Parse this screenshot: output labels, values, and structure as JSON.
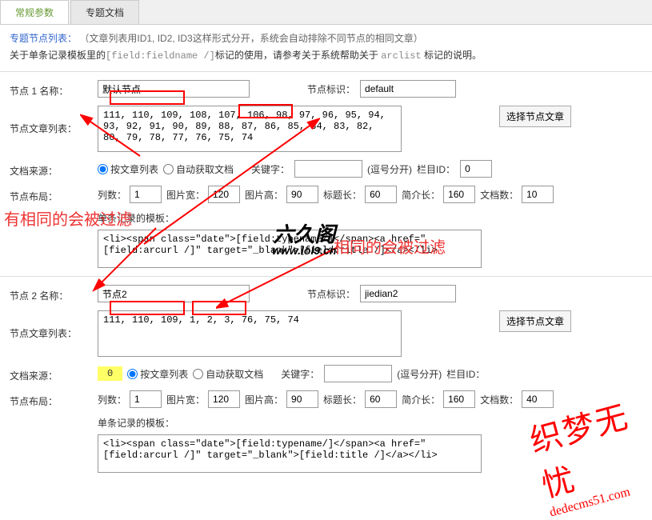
{
  "tabs": {
    "regular": "常规参数",
    "special": "专题文档"
  },
  "info": {
    "title": "专题节点列表：",
    "paren": "（文章列表用ID1, ID2, ID3这样形式分开，系统会自动排除不同节点的相同文章）",
    "line2a": "关于单条记录模板里的",
    "line2_mono1": "[field:fieldname /]",
    "line2b": "标记的使用，请参考关于系统帮助关于 ",
    "line2_mono2": "arclist",
    "line2c": " 标记的说明。"
  },
  "labels": {
    "node_name": "节点 1 名称：",
    "node_name2": "节点 2 名称：",
    "node_flag": "节点标识：",
    "article_list": "节点文章列表：",
    "select_btn": "选择节点文章",
    "doc_source": "文档来源：",
    "by_article": "按文章列表",
    "auto_fetch": "自动获取文档",
    "keyword": "关键字：",
    "comma_sep": "(逗号分开)",
    "column_id": "栏目ID：",
    "layout": "节点布局：",
    "cols": "列数：",
    "img_w": "图片宽：",
    "img_h": "图片高：",
    "title_len": "标题长：",
    "intro_len": "简介长：",
    "doc_count": "文档数：",
    "template": "单条记录的模板："
  },
  "node1": {
    "name": "默认节点",
    "flag": "default",
    "arclist": "111, 110, 109, 108, 107, 106, 98, 97, 96, 95, 94, 93, 92, 91, 90, 89, 88, 87, 86, 85, 84, 83, 82, 80, 79, 78, 77, 76, 75, 74",
    "keyword": "",
    "column_id": "0",
    "cols": "1",
    "imgw": "120",
    "imgh": "90",
    "titlelen": "60",
    "introlen": "160",
    "doccount": "10",
    "template": "<li><span class=\"date\">[field:typename/]</span><a href=\"[field:arcurl /]\" target=\"_blank\">[field:title /]</a></li>"
  },
  "node2": {
    "name": "节点2",
    "flag": "jiedian2",
    "arclist": "111, 110, 109, 1, 2, 3, 76, 75, 74",
    "keyword": "",
    "column_id": "",
    "cols": "1",
    "imgw": "120",
    "imgh": "90",
    "titlelen": "60",
    "introlen": "160",
    "doccount": "40",
    "template": "<li><span class=\"date\">[field:typename/]</span><a href=\"[field:arcurl /]\" target=\"_blank\">[field:title /]</a></li>",
    "highlight_zero": "0"
  },
  "annotations": {
    "filter1": "有相同的会被过滤",
    "filter2": "相同的会被过滤"
  },
  "watermark": {
    "brand_big": "六久阁",
    "brand_url": "www.lol9.cn",
    "red_line1": "织梦无忧",
    "red_url": "dedecms51.com"
  }
}
